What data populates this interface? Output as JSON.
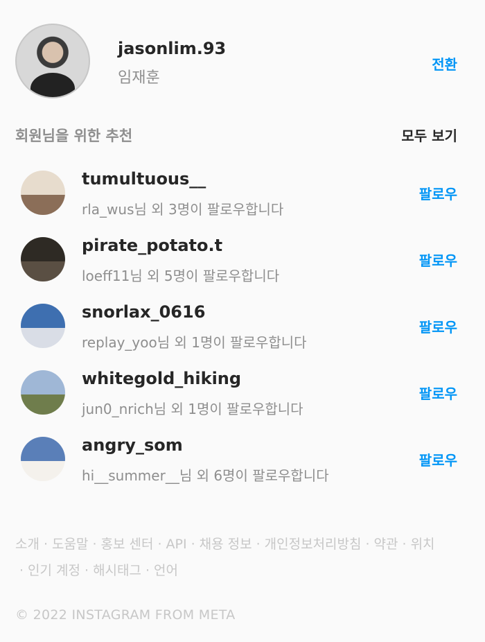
{
  "profile": {
    "username": "jasonlim.93",
    "fullname": "임재훈",
    "switch_label": "전환"
  },
  "suggestions_header": {
    "title": "회원님을 위한 추천",
    "see_all": "모두 보기"
  },
  "suggestions": [
    {
      "username": "tumultuous__",
      "subtitle": "rla_wus님 외 3명이 팔로우합니다",
      "follow_label": "팔로우",
      "avatar_colors": [
        "#e7dccd",
        "#8b6e58"
      ]
    },
    {
      "username": "pirate_potato.t",
      "subtitle": "loeff11님 외 5명이 팔로우합니다",
      "follow_label": "팔로우",
      "avatar_colors": [
        "#2e2a24",
        "#5a4f43"
      ]
    },
    {
      "username": "snorlax_0616",
      "subtitle": "replay_yoo님 외 1명이 팔로우합니다",
      "follow_label": "팔로우",
      "avatar_colors": [
        "#3e6fb0",
        "#d9dde6"
      ]
    },
    {
      "username": "whitegold_hiking",
      "subtitle": "jun0_nrich님 외 1명이 팔로우합니다",
      "follow_label": "팔로우",
      "avatar_colors": [
        "#9fb7d6",
        "#6f7d4c"
      ]
    },
    {
      "username": "angry_som",
      "subtitle": "hi__summer__님 외 6명이 팔로우합니다",
      "follow_label": "팔로우",
      "avatar_colors": [
        "#5a7fb8",
        "#f4f1ec"
      ]
    }
  ],
  "footer": {
    "links": [
      "소개",
      "도움말",
      "홍보 센터",
      "API",
      "채용 정보",
      "개인정보처리방침",
      "약관",
      "위치",
      "인기 계정",
      "해시태그",
      "언어"
    ],
    "separator": "·",
    "copyright": "© 2022 INSTAGRAM FROM META"
  }
}
